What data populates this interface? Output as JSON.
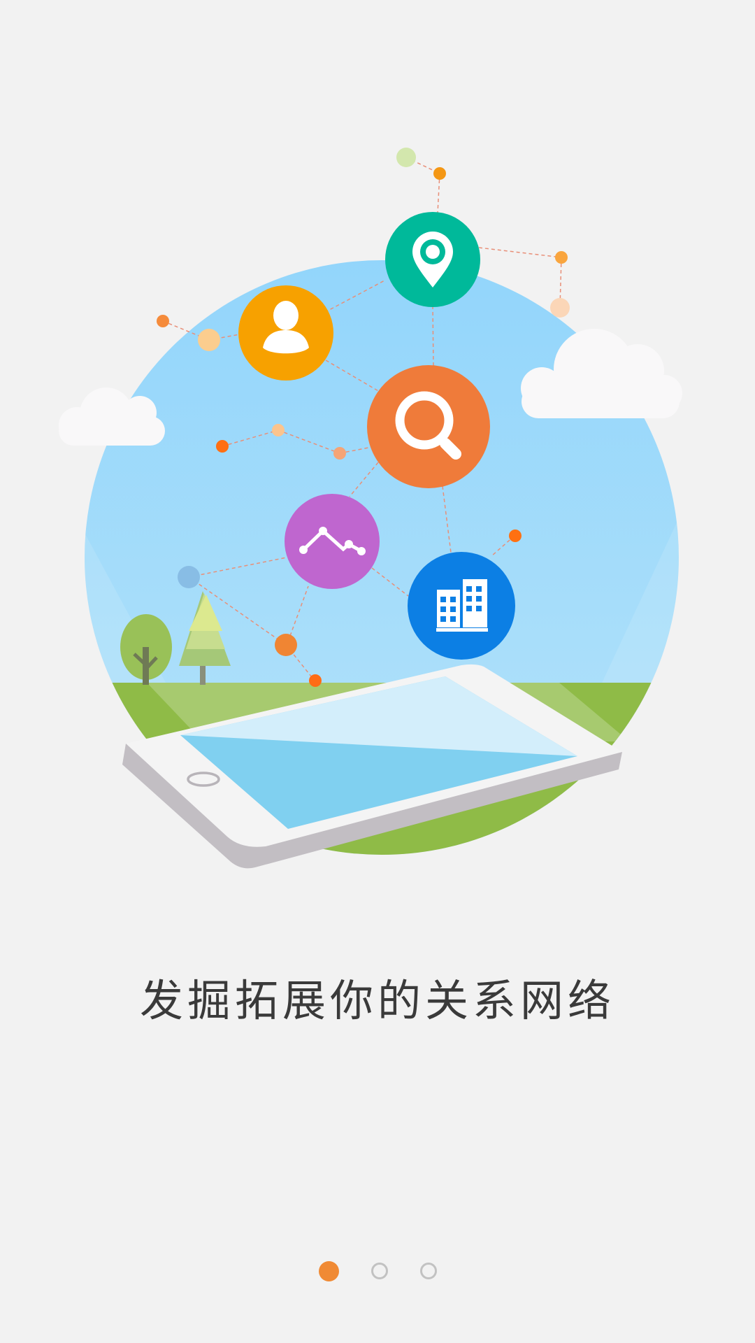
{
  "onboarding": {
    "headline": "发掘拓展你的关系网络",
    "current_page": 1,
    "page_count": 3
  },
  "colors": {
    "background": "#f2f2f2",
    "accent": "#f08a34",
    "sky": "#97d8fb",
    "grass": "#8fbb47",
    "location": "#00b99a",
    "person": "#f7a100",
    "search": "#ef7b3a",
    "analytics": "#bf66cf",
    "company": "#0c7fe4"
  },
  "icons": [
    "location-pin-icon",
    "person-icon",
    "search-icon",
    "analytics-icon",
    "building-icon"
  ],
  "pager": {
    "dots": [
      {
        "active": true
      },
      {
        "active": false
      },
      {
        "active": false
      }
    ]
  }
}
